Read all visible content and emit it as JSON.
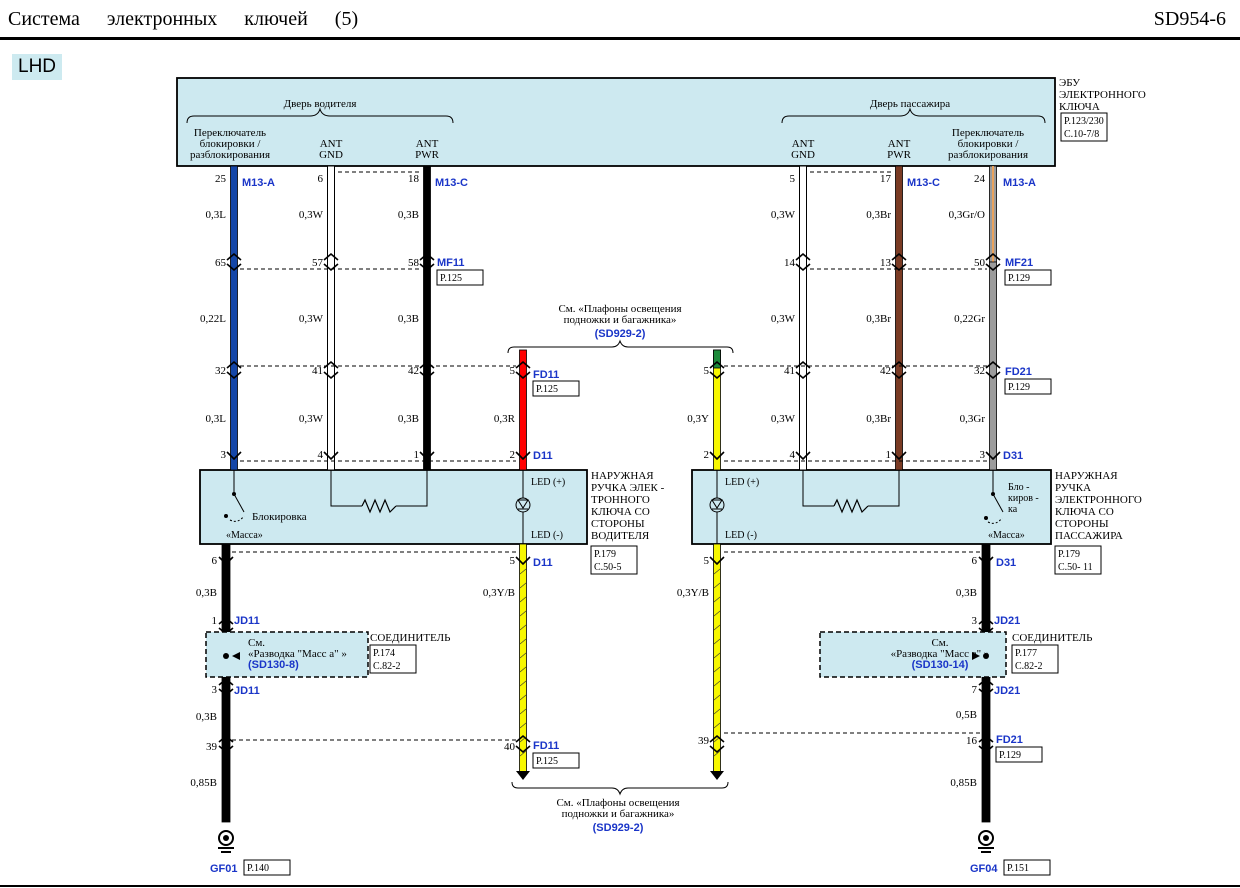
{
  "header": {
    "title": "Система электронных ключей (5)",
    "code": "SD954-6"
  },
  "mode": "LHD",
  "colors": {
    "box": "#cde9f0",
    "blue_label": "#1a35c8",
    "wire_blue": "#1446a8",
    "wire_brown": "#7a3b24",
    "wire_red": "#ff0000",
    "wire_yellow": "#f7f700",
    "wire_green": "#1c8a3a",
    "wire_gray": "#9c9c9c",
    "wire_orange": "#e8a25c"
  },
  "ecu": {
    "title_lines": [
      "ЭБУ",
      "ЭЛЕКТРОННОГО",
      "КЛЮЧА"
    ],
    "refs": [
      "P.123/230",
      "C.10-7/8"
    ],
    "driver_group": "Дверь водителя",
    "passenger_group": "Дверь пассажира",
    "pins": {
      "d_lock": [
        "Переключатель",
        "блокировки /",
        "разблокирования"
      ],
      "d_gnd": [
        "ANT",
        "GND"
      ],
      "d_pwr": [
        "ANT",
        "PWR"
      ],
      "p_gnd": [
        "ANT",
        "GND"
      ],
      "p_pwr": [
        "ANT",
        "PWR"
      ],
      "p_lock": [
        "Переключатель",
        "блокировки /",
        "разблокирования"
      ]
    }
  },
  "connectors": {
    "m13a": "M13-A",
    "m13c": "M13-C",
    "mf11": "MF11",
    "mf21": "MF21",
    "fd11": "FD11",
    "fd21": "FD21",
    "d11": "D11",
    "d31": "D31",
    "jd11": "JD11",
    "jd21": "JD21",
    "gf01": "GF01",
    "gf04": "GF04"
  },
  "refs": {
    "mf11": "P.125",
    "mf21": "P.129",
    "fd11": "P.125",
    "fd21": "P.129",
    "fd11_bottom": "P.125",
    "fd21_bottom": "P.129",
    "gf01": "P.140",
    "gf04": "P.151",
    "d11": [
      "P.179",
      "C.50-5"
    ],
    "d31": [
      "P.179",
      "C.50- 11"
    ],
    "jd11": [
      "P.174",
      "C.82-2"
    ],
    "jd21": [
      "P.177",
      "C.82-2"
    ]
  },
  "pins": {
    "w1": [
      "25",
      "65",
      "32",
      "3"
    ],
    "w2": [
      "6",
      "57",
      "41",
      "4"
    ],
    "w3": [
      "18",
      "58",
      "42",
      "1"
    ],
    "w4": [
      "5",
      "2"
    ],
    "w5": [
      "5",
      "2"
    ],
    "w6": [
      "5",
      "14",
      "41",
      "4"
    ],
    "w7": [
      "17",
      "13",
      "42",
      "1"
    ],
    "w8": [
      "24",
      "50",
      "32",
      "3"
    ],
    "b_left": [
      "6",
      "1",
      "3",
      "39"
    ],
    "b_left_y": [
      "5",
      "40"
    ],
    "b_right_y": [
      "5",
      "39"
    ],
    "b_right": [
      "6",
      "3",
      "7",
      "16"
    ]
  },
  "wire_labels": {
    "w1": [
      "0,3L",
      "0,22L",
      "0,3L"
    ],
    "w2": [
      "0,3W",
      "0,3W",
      "0,3W"
    ],
    "w3": [
      "0,3B",
      "0,3B",
      "0,3B"
    ],
    "w4": "0,3R",
    "w5": "0,3Y",
    "w6": [
      "0,3W",
      "0,3W",
      "0,3W"
    ],
    "w7": [
      "0,3Br",
      "0,3Br",
      "0,3Br"
    ],
    "w8": [
      "0,3Gr/O",
      "0,22Gr",
      "0,3Gr"
    ],
    "bl": [
      "0,3B",
      "0,3B",
      "0,85B"
    ],
    "bly": "0,3Y/B",
    "bry": "0,3Y/B",
    "br": [
      "0,3B",
      "0,5B",
      "0,85B"
    ]
  },
  "driver_handle": {
    "title_lines": [
      "НАРУЖНАЯ",
      "РУЧКА ЭЛЕК -",
      "ТРОННОГО",
      "КЛЮЧА СО",
      "СТОРОНЫ",
      "ВОДИТЕЛЯ"
    ],
    "lock": "Блокировка",
    "mass": "«Масса»",
    "led_plus": "LED (+)",
    "led_minus": "LED (-)"
  },
  "passenger_handle": {
    "title_lines": [
      "НАРУЖНАЯ",
      "РУЧКА",
      "ЭЛЕКТРОННОГО",
      "КЛЮЧА СО",
      "СТОРОНЫ",
      "ПАССАЖИРА"
    ],
    "lock_lines": [
      "Бло -",
      "киров -",
      "ка"
    ],
    "mass": "«Масса»",
    "led_plus": "LED (+)",
    "led_minus": "LED (-)"
  },
  "joints": {
    "label": "СОЕДИНИТЕЛЬ",
    "left_lines": [
      "См.",
      "«Разводка    \"Масс а\" »"
    ],
    "left_link": "(SD130-8)",
    "right_lines": [
      "См.",
      "«Разводка    \"Масс а\" »"
    ],
    "right_link": "(SD130-14)"
  },
  "notes": {
    "top_lines": [
      "См. «Плафоны  освещения",
      "подножки   и багажника»"
    ],
    "top_link": "(SD929-2)",
    "bottom_lines": [
      "См. «Плафоны  освещения",
      "подножки   и багажника»"
    ],
    "bottom_link": "(SD929-2)"
  }
}
